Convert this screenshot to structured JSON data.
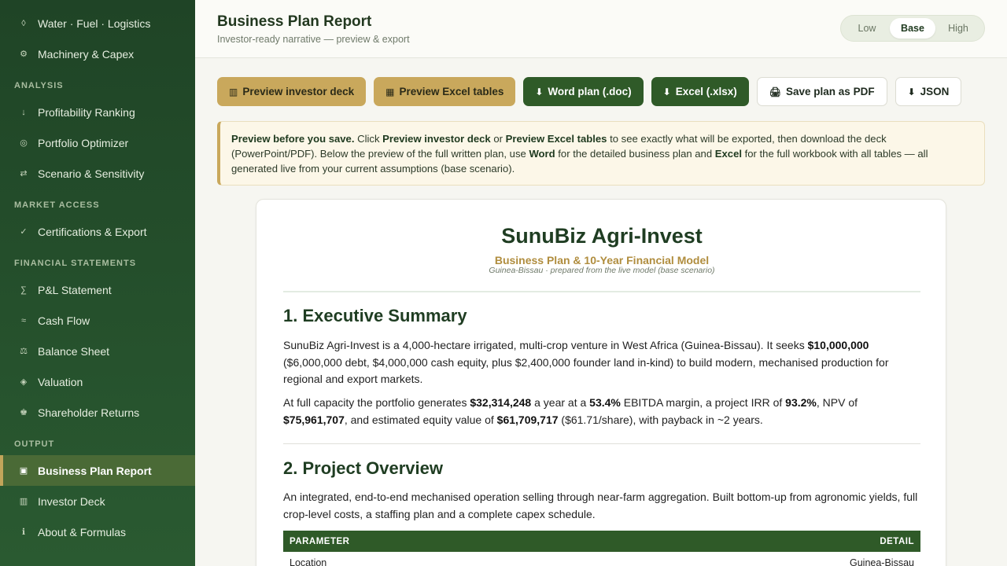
{
  "sidebar": {
    "items_top": [
      {
        "icon": "◊",
        "label": "Water · Fuel · Logistics"
      },
      {
        "icon": "⚙",
        "label": "Machinery & Capex"
      }
    ],
    "sections": [
      {
        "title": "ANALYSIS",
        "items": [
          {
            "icon": "↓",
            "label": "Profitability Ranking"
          },
          {
            "icon": "◎",
            "label": "Portfolio Optimizer"
          },
          {
            "icon": "⇄",
            "label": "Scenario & Sensitivity"
          }
        ]
      },
      {
        "title": "MARKET ACCESS",
        "items": [
          {
            "icon": "✓",
            "label": "Certifications & Export"
          }
        ]
      },
      {
        "title": "FINANCIAL STATEMENTS",
        "items": [
          {
            "icon": "∑",
            "label": "P&L Statement"
          },
          {
            "icon": "≈",
            "label": "Cash Flow"
          },
          {
            "icon": "⚖",
            "label": "Balance Sheet"
          },
          {
            "icon": "◈",
            "label": "Valuation"
          },
          {
            "icon": "♚",
            "label": "Shareholder Returns"
          }
        ]
      },
      {
        "title": "OUTPUT",
        "items": [
          {
            "icon": "▣",
            "label": "Business Plan Report",
            "active": true
          },
          {
            "icon": "▥",
            "label": "Investor Deck"
          },
          {
            "icon": "ℹ",
            "label": "About & Formulas"
          }
        ]
      }
    ]
  },
  "header": {
    "title": "Business Plan Report",
    "subtitle": "Investor-ready narrative — preview & export",
    "scenario": {
      "options": [
        "Low",
        "Base",
        "High"
      ],
      "selected": "Base"
    }
  },
  "toolbar": {
    "preview_deck": {
      "icon": "▥",
      "label": "Preview investor deck"
    },
    "preview_excel": {
      "icon": "▦",
      "label": "Preview Excel tables"
    },
    "word": {
      "icon": "⬇",
      "label": "Word plan (.doc)"
    },
    "excel": {
      "icon": "⬇",
      "label": "Excel (.xlsx)"
    },
    "pdf": {
      "icon": "🖨",
      "label": "Save plan as PDF"
    },
    "json": {
      "icon": "⬇",
      "label": "JSON"
    }
  },
  "notice": {
    "lead": "Preview before you save.",
    "t1": " Click ",
    "b1": "Preview investor deck",
    "t2": " or ",
    "b2": "Preview Excel tables",
    "t3": " to see exactly what will be exported, then download the deck (PowerPoint/PDF). Below the preview of the full written plan, use ",
    "b3": "Word",
    "t4": " for the detailed business plan and ",
    "b4": "Excel",
    "t5": " for the full workbook with all tables — all generated live from your current assumptions (base scenario)."
  },
  "document": {
    "title": "SunuBiz Agri-Invest",
    "subtitle": "Business Plan & 10-Year Financial Model",
    "meta": "Guinea-Bissau · prepared from the live model (base scenario)",
    "section1": {
      "heading": "1. Executive Summary",
      "p1_a": "SunuBiz Agri-Invest is a 4,000-hectare irrigated, multi-crop venture in West Africa (Guinea-Bissau). It seeks ",
      "p1_b": "$10,000,000",
      "p1_c": " ($6,000,000 debt, $4,000,000 cash equity, plus $2,400,000 founder land in-kind) to build modern, mechanised production for regional and export markets.",
      "p2_a": "At full capacity the portfolio generates ",
      "p2_b": "$32,314,248",
      "p2_c": " a year at a ",
      "p2_d": "53.4%",
      "p2_e": " EBITDA margin, a project IRR of ",
      "p2_f": "93.2%",
      "p2_g": ", NPV of ",
      "p2_h": "$75,961,707",
      "p2_i": ", and estimated equity value of ",
      "p2_j": "$61,709,717",
      "p2_k": " ($61.71/share), with payback in ~2 years."
    },
    "section2": {
      "heading": "2. Project Overview",
      "p1": "An integrated, end-to-end mechanised operation selling through near-farm aggregation. Built bottom-up from agronomic yields, full crop-level costs, a staffing plan and a complete capex schedule.",
      "table": {
        "headers": [
          "PARAMETER",
          "DETAIL"
        ],
        "rows": [
          [
            "Location",
            "Guinea-Bissau"
          ]
        ]
      }
    }
  }
}
